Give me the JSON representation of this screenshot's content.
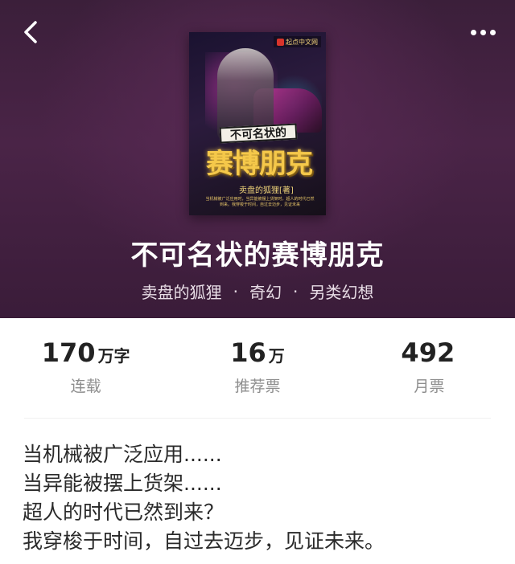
{
  "header": {
    "back_icon": "chevron-left-icon",
    "more_icon": "more-horizontal-icon"
  },
  "cover": {
    "publisher_logo": "起点中文网",
    "subtitle": "不可名状的",
    "title": "赛博朋克",
    "author_line": "卖盘的狐狸[著]",
    "tagline": "当机械被广泛应用时，当异能被摆上货架时，超人的时代已然到来。我穿梭于时间，自过去迈步，见证未来"
  },
  "book": {
    "title": "不可名状的赛博朋克",
    "author": "卖盘的狐狸",
    "genre": "奇幻",
    "subgenre": "另类幻想",
    "separator": "·"
  },
  "stats": [
    {
      "value": "170",
      "unit": "万字",
      "label": "连载"
    },
    {
      "value": "16",
      "unit": "万",
      "label": "推荐票"
    },
    {
      "value": "492",
      "unit": "",
      "label": "月票"
    }
  ],
  "synopsis": [
    "当机械被广泛应用......",
    "当异能被摆上货架......",
    "超人的时代已然到来？",
    "我穿梭于时间，自过去迈步，见证未来。"
  ],
  "colors": {
    "hero_bg": "#3b1f3a",
    "title": "#ffffff",
    "meta": "#e8dde6",
    "stat_value": "#222222",
    "stat_label": "#8e8e8e",
    "synopsis_text": "#2a2a2a"
  }
}
